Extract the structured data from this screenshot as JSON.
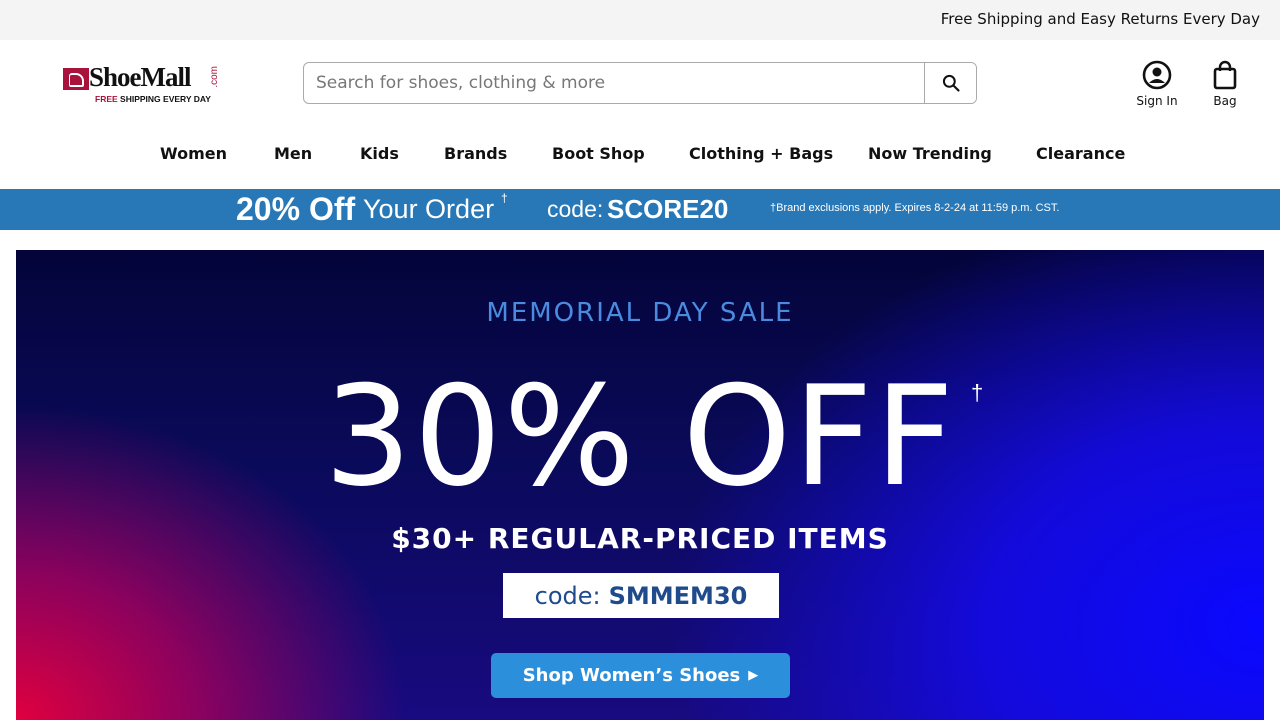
{
  "topbar": {
    "message": "Free Shipping and Easy Returns Every Day"
  },
  "logo": {
    "name": "ShoeMall",
    "suffix": ".com",
    "tagline_free": "FREE",
    "tagline_rest": "SHIPPING EVERY DAY",
    "brand_color": "#a8123b"
  },
  "search": {
    "placeholder": "Search for shoes, clothing & more",
    "icon": "search-icon"
  },
  "account": {
    "signin_label": "Sign In",
    "signin_icon": "user-circle-icon",
    "bag_label": "Bag",
    "bag_icon": "shopping-bag-icon"
  },
  "nav": {
    "items": [
      "Women",
      "Men",
      "Kids",
      "Brands",
      "Boot Shop",
      "Clothing + Bags",
      "Now Trending",
      "Clearance"
    ]
  },
  "promo": {
    "discount": "20% Off",
    "your_order": "Your Order",
    "dagger": "†",
    "code_label": "code:",
    "code": "SCORE20",
    "fine_print": "†Brand exclusions apply. Expires 8-2-24 at 11:59 p.m. CST.",
    "bg_color": "#2878b8"
  },
  "hero": {
    "kicker": "MEMORIAL DAY SALE",
    "headline": "30% OFF",
    "dagger": "†",
    "subhead": "$30+ REGULAR-PRICED ITEMS",
    "code_label": "code:",
    "code": "SMMEM30",
    "cta": "Shop Women’s Shoes",
    "cta_color": "#2b8fdc"
  }
}
